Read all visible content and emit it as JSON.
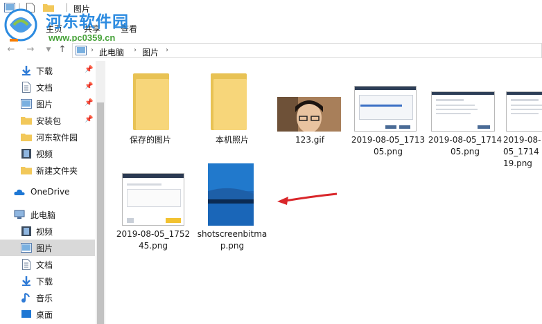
{
  "watermark": {
    "title": "河东软件园",
    "url": "www.pc0359.cn"
  },
  "titlebar": {
    "title": "图片"
  },
  "ribbon": {
    "tabs": [
      {
        "label": "文件"
      },
      {
        "label": "主页"
      },
      {
        "label": "共享"
      },
      {
        "label": "查看"
      }
    ]
  },
  "address": {
    "breadcrumb": [
      "此电脑",
      "图片"
    ]
  },
  "sidebar": {
    "items": [
      {
        "label": "下载",
        "icon": "download-arrow-icon",
        "pinned": true
      },
      {
        "label": "文档",
        "icon": "document-icon",
        "pinned": true
      },
      {
        "label": "图片",
        "icon": "picture-icon",
        "pinned": true
      },
      {
        "label": "安装包",
        "icon": "folder-icon",
        "pinned": true
      },
      {
        "label": "河东软件园",
        "icon": "folder-icon",
        "pinned": false
      },
      {
        "label": "视频",
        "icon": "film-icon",
        "pinned": false
      },
      {
        "label": "新建文件夹",
        "icon": "folder-icon",
        "pinned": false
      },
      {
        "label": "OneDrive",
        "icon": "cloud-icon",
        "pinned": false
      },
      {
        "label": "此电脑",
        "icon": "computer-icon",
        "pinned": false
      },
      {
        "label": "视频",
        "icon": "film-icon",
        "pinned": false
      },
      {
        "label": "图片",
        "icon": "picture-icon",
        "pinned": false,
        "selected": true
      },
      {
        "label": "文档",
        "icon": "document-icon",
        "pinned": false
      },
      {
        "label": "下载",
        "icon": "download-arrow-icon",
        "pinned": false
      },
      {
        "label": "音乐",
        "icon": "music-note-icon",
        "pinned": false
      },
      {
        "label": "桌面",
        "icon": "desktop-icon",
        "pinned": false
      }
    ]
  },
  "files": [
    {
      "name": "保存的图片",
      "kind": "folder"
    },
    {
      "name": "本机照片",
      "kind": "folder"
    },
    {
      "name": "123.gif",
      "kind": "photo"
    },
    {
      "name": "2019-08-05_171305.png",
      "kind": "screenshot"
    },
    {
      "name": "2019-08-05_171405.png",
      "kind": "screenshot"
    },
    {
      "name": "2019-08-05_171419.png",
      "kind": "screenshot"
    },
    {
      "name": "2019-08-05_175245.png",
      "kind": "screenshot"
    },
    {
      "name": "shotscreenbitmap.png",
      "kind": "bluebitmap"
    }
  ],
  "colors": {
    "accent": "#2c8be0",
    "selection": "#cde5f7",
    "folder": "#f7d67a",
    "arrow": "#d9262a"
  }
}
